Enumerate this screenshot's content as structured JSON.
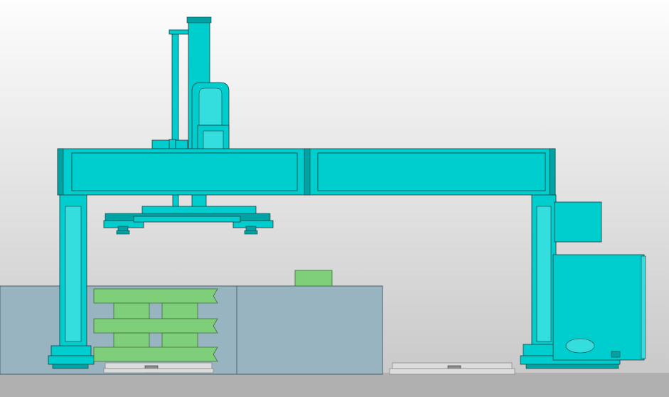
{
  "scene": {
    "name": "gantry-palletizer-robot-side-view",
    "colors": {
      "background_top": "#fdfdfd",
      "background_bottom": "#c6c6c6",
      "machine": "#00cdcd",
      "machine_light": "#34dede",
      "machine_dark": "#00a3a3",
      "outline": "#1e3a3a",
      "conveyor": "#99b4c1",
      "conveyor_line": "#4a5f69",
      "product": "#7fcf7a",
      "product_line": "#3d6e3a",
      "pallet": "#dcdcdc",
      "pallet_dark": "#8a8a8a",
      "ground": "#b0b0b0"
    },
    "pallet_stack_layers": 3,
    "incoming_cartons": 1
  }
}
